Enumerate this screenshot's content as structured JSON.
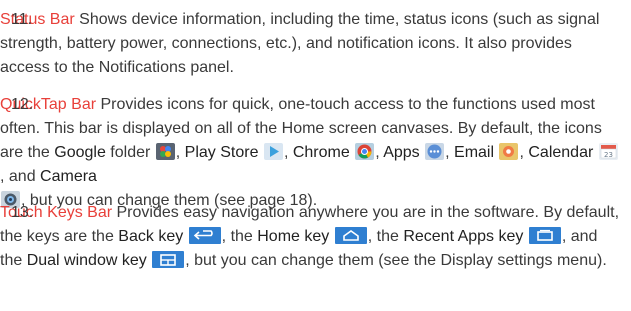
{
  "items": [
    {
      "number": "11.",
      "title": "Status Bar",
      "text": " Shows device information, including the time, status icons (such as signal strength, battery power, connections, etc.), and notification icons. It also provides access to the Notifications panel."
    },
    {
      "number": "12.",
      "title": "QuickTap Bar",
      "text_1": " Provides icons for quick, one-touch access to the functions used most often. This bar is displayed on all of the Home screen canvases. By default, the icons are the ",
      "google": "Google",
      "text_2": " folder ",
      "play_store": "Play Store",
      "chrome": "Chrome",
      "apps": "Apps",
      "email": "Email",
      "calendar": "Calendar",
      "and": ", and ",
      "camera": "Camera",
      "comma": ", ",
      "text_end": ", but you can change them (see page 18)."
    },
    {
      "number": "13.",
      "title": "Touch Keys Bar",
      "text_1": " Provides easy navigation anywhere you are in the software. By default, the keys are the ",
      "back_key": "Back key",
      "the": ", the ",
      "home_key": "Home key",
      "the2": ", the ",
      "recent_apps_key": "Recent Apps key",
      "and": ", and the ",
      "dual_window_key": "Dual window key",
      "text_end": ", but you can change them (see the Display settings menu)."
    }
  ],
  "icons": {
    "google_folder": "google-folder-icon",
    "play_store": "play-store-icon",
    "chrome": "chrome-icon",
    "apps": "apps-icon",
    "email": "email-icon",
    "calendar": "calendar-icon",
    "camera": "camera-icon",
    "back_key": "back-key-icon",
    "home_key": "home-key-icon",
    "recent_apps_key": "recent-apps-key-icon",
    "dual_window_key": "dual-window-key-icon"
  },
  "colors": {
    "title": "#e8403a",
    "text": "#3a3a3a",
    "key_blue": "#2f7fd1"
  }
}
